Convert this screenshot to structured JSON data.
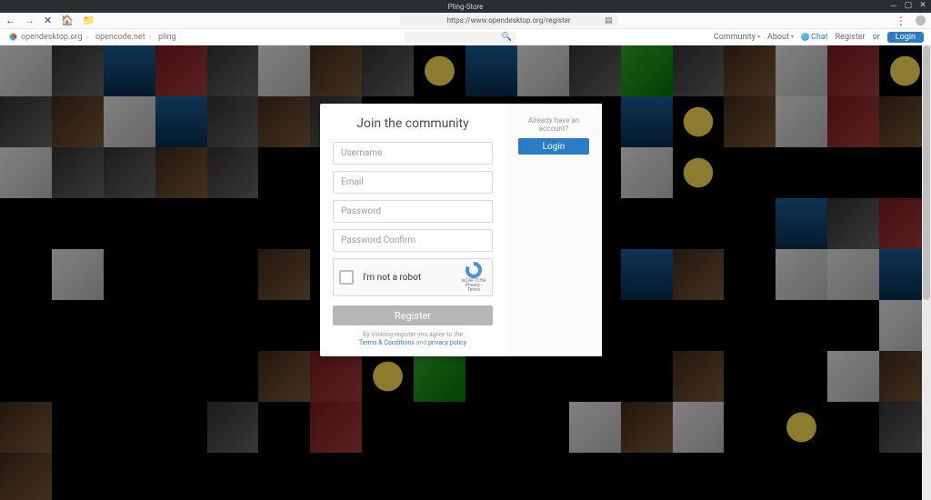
{
  "window": {
    "title": "Pling-Store"
  },
  "browser": {
    "url": "https://www.opendesktop.org/register"
  },
  "siteheader": {
    "crumbs": [
      "opendesktop.org",
      "opencode.net",
      "pling"
    ],
    "menus": {
      "community": "Community",
      "about": "About",
      "chat": "Chat"
    },
    "register_text": "Register",
    "or_text": "or",
    "login_text": "Login"
  },
  "modal": {
    "title": "Join the community",
    "fields": {
      "username": "Username",
      "email": "Email",
      "password": "Password",
      "password_confirm": "Password Confirm"
    },
    "captcha": {
      "label": "I'm not a robot",
      "badge_line1": "reCAPTCHA",
      "badge_line2": "Privacy - Terms"
    },
    "register_button": "Register",
    "agree_prefix": "By clicking register you agree to the",
    "terms_link": "Terms & Conditions",
    "and_text": "and",
    "privacy_link": "privacy policy",
    "already_text": "Already have an account?",
    "login_button": "Login"
  }
}
